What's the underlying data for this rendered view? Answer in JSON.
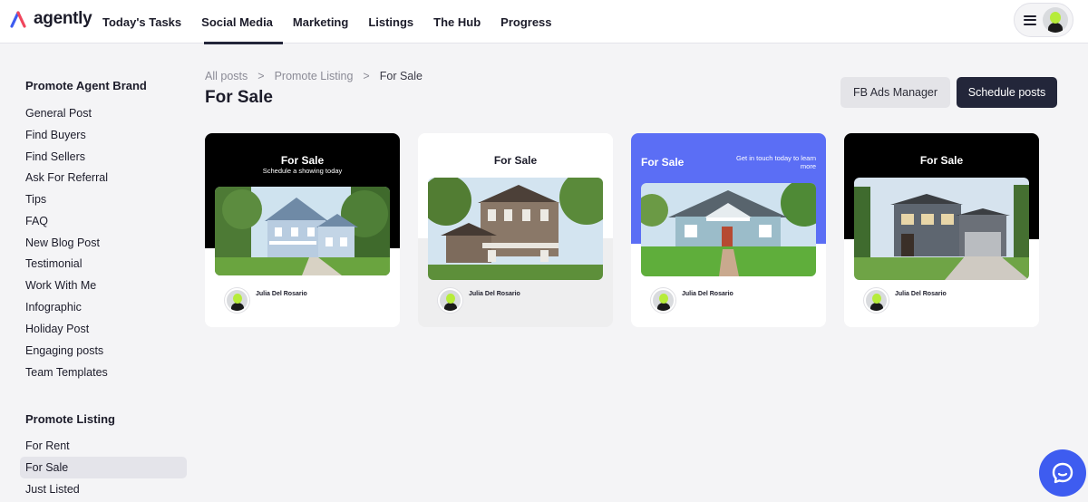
{
  "app": {
    "logo_text": "agently"
  },
  "nav": {
    "items": [
      {
        "label": "Today's Tasks"
      },
      {
        "label": "Social Media"
      },
      {
        "label": "Marketing"
      },
      {
        "label": "Listings"
      },
      {
        "label": "The Hub"
      },
      {
        "label": "Progress"
      }
    ],
    "active": "Social Media"
  },
  "sidebar": {
    "section1_title": "Promote Agent Brand",
    "section1_items": [
      {
        "label": "General Post"
      },
      {
        "label": "Find Buyers"
      },
      {
        "label": "Find Sellers"
      },
      {
        "label": "Ask For Referral"
      },
      {
        "label": "Tips"
      },
      {
        "label": "FAQ"
      },
      {
        "label": "New Blog Post"
      },
      {
        "label": "Testimonial"
      },
      {
        "label": "Work With Me"
      },
      {
        "label": "Infographic"
      },
      {
        "label": "Holiday Post"
      },
      {
        "label": "Engaging posts"
      },
      {
        "label": "Team Templates"
      }
    ],
    "section2_title": "Promote Listing",
    "section2_items": [
      {
        "label": "For Rent"
      },
      {
        "label": "For Sale"
      },
      {
        "label": "Just Listed"
      }
    ],
    "active_item": "For Sale"
  },
  "breadcrumb": {
    "items": [
      {
        "label": "All posts"
      },
      {
        "label": "Promote Listing"
      },
      {
        "label": "For Sale"
      }
    ],
    "separator": ">"
  },
  "page": {
    "title": "For Sale",
    "fb_ads_label": "FB Ads Manager",
    "schedule_label": "Schedule posts"
  },
  "cards": [
    {
      "heading": "For Sale",
      "subheading": "Schedule a showing today",
      "author": "Julia Del Rosario",
      "style": "black-band"
    },
    {
      "heading": "For Sale",
      "subheading": "",
      "author": "Julia Del Rosario",
      "style": "white-top-grey-bottom"
    },
    {
      "heading": "For Sale",
      "subheading": "Get in touch today to learn more",
      "author": "Julia Del Rosario",
      "style": "blue-band"
    },
    {
      "heading": "For Sale",
      "subheading": "",
      "author": "Julia Del Rosario",
      "style": "black-band"
    }
  ],
  "icons": {
    "logo": "agently-logo-icon",
    "menu": "hamburger-menu-icon",
    "chat": "chat-bubble-icon"
  },
  "colors": {
    "accent_dark": "#23263a",
    "brand_blue": "#3e5cf0",
    "card_blue": "#5b6ef5",
    "avatar_green": "#b6ec3a"
  }
}
